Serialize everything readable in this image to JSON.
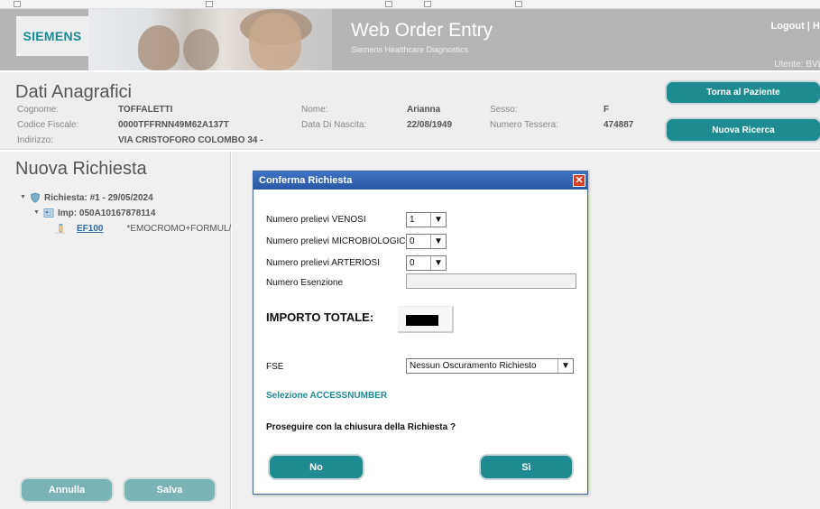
{
  "header": {
    "logo_text": "SIEMENS",
    "app_title": "Web Order Entry",
    "app_subtitle": "Siemens Healthcare Diagnostics",
    "links": "Logout | He",
    "user": "Utente: BVLI"
  },
  "patient": {
    "section_title": "Dati Anagrafici",
    "fields": {
      "cognome": {
        "label": "Cognome:",
        "value": "TOFFALETTI"
      },
      "codice_fiscale": {
        "label": "Codice Fiscale:",
        "value": "0000TFFRNN49M62A137T"
      },
      "indirizzo": {
        "label": "Indirizzo:",
        "value": "VIA CRISTOFORO COLOMBO 34 -"
      },
      "nome": {
        "label": "Nome:",
        "value": "Arianna"
      },
      "data_nascita": {
        "label": "Data Di Nascita:",
        "value": "22/08/1949"
      },
      "sesso": {
        "label": "Sesso:",
        "value": "F"
      },
      "numero_tessera": {
        "label": "Numero Tessera:",
        "value": "474887"
      }
    },
    "btn_torna": "Torna al Paziente",
    "btn_nuova_ricerca": "Nuova Ricerca"
  },
  "request_panel": {
    "title": "Nuova Richiesta",
    "tree": {
      "request": "Richiesta: #1 - 29/05/2024",
      "impegnativa": "Imp: 050A10167878114",
      "exam_code": "EF100",
      "exam_desc": "*EMOCROMO+FORMUL/"
    },
    "btn_annulla": "Annulla",
    "btn_salva": "Salva"
  },
  "dialog": {
    "title": "Conferma Richiesta",
    "close_symbol": "✕",
    "venosi_label": "Numero prelievi VENOSI",
    "venosi_value": "1",
    "micro_label": "Numero prelievi MICROBIOLOGICI",
    "micro_value": "0",
    "arteriosi_label": "Numero prelievi ARTERIOSI",
    "arteriosi_value": "0",
    "esenzione_label": "Numero Esenzione",
    "importo_label": "IMPORTO TOTALE:",
    "fse_label": "FSE",
    "fse_value": "Nessun Oscuramento Richiesto",
    "accessnumber_link": "Selezione ACCESSNUMBER",
    "question": "Proseguire con la chiusura della Richiesta ?",
    "btn_no": "No",
    "btn_si": "Sì"
  },
  "colors": {
    "teal_button": "#1e8a91",
    "pale_button": "#79b3b5",
    "dialog_title": "#2a58a6",
    "close_red": "#d73c25",
    "brand_logo": "#1a8a94"
  },
  "icons": {
    "dropdown": "▼",
    "tree_collapse": "▼"
  }
}
